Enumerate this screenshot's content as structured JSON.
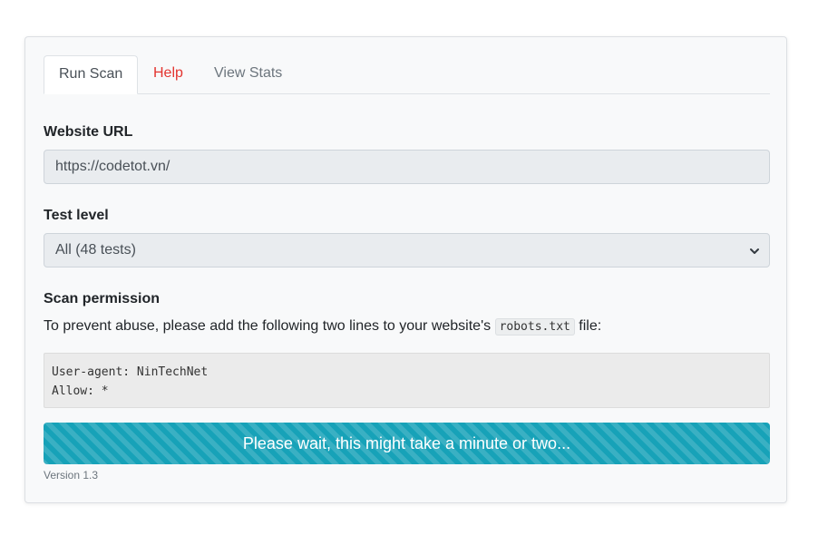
{
  "tabs": [
    {
      "label": "Run Scan",
      "active": true
    },
    {
      "label": "Help",
      "active": false
    },
    {
      "label": "View Stats",
      "active": false
    }
  ],
  "url_field": {
    "label": "Website URL",
    "value": "https://codetot.vn/"
  },
  "test_level": {
    "label": "Test level",
    "selected": "All (48 tests)"
  },
  "permission": {
    "label": "Scan permission",
    "text_before": "To prevent abuse, please add the following two lines to your website's ",
    "filename": "robots.txt",
    "text_after": " file:",
    "code_lines": [
      "User-agent: NinTechNet",
      "Allow: *"
    ]
  },
  "progress": {
    "label": "Please wait, this might take a minute or two...",
    "value": 100
  },
  "version": "Version 1.3",
  "colors": {
    "progress": "#17a2b8",
    "help_tab": "#e3342f",
    "card_bg": "#f8f9fa"
  }
}
